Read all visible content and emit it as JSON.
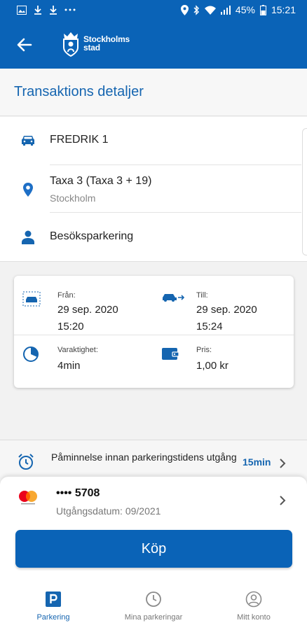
{
  "status_bar": {
    "battery": "45%",
    "time": "15:21"
  },
  "brand": {
    "line1": "Stockholms",
    "line2": "stad"
  },
  "page_title": "Transaktions detaljer",
  "vehicle": {
    "name": "FREDRIK 1"
  },
  "zone": {
    "name": "Taxa 3 (Taxa 3 + 19)",
    "city": "Stockholm"
  },
  "permit": {
    "type": "Besöksparkering"
  },
  "details": {
    "from": {
      "label": "Från:",
      "date": "29 sep. 2020",
      "time": "15:20"
    },
    "to": {
      "label": "Till:",
      "date": "29 sep. 2020",
      "time": "15:24"
    },
    "duration": {
      "label": "Varaktighet:",
      "value": "4min"
    },
    "price": {
      "label": "Pris:",
      "value": "1,00 kr"
    }
  },
  "reminder": {
    "label": "Påminnelse innan parkeringstidens utgång",
    "value": "15min"
  },
  "payment": {
    "card_number": "•••• 5708",
    "expiry": "Utgångsdatum: 09/2021"
  },
  "buy_button": "Köp",
  "bottom_nav": {
    "items": [
      {
        "label": "Parkering",
        "icon": "parking-icon",
        "active": true
      },
      {
        "label": "Mina parkeringar",
        "icon": "clock-icon",
        "active": false
      },
      {
        "label": "Mitt konto",
        "icon": "account-icon",
        "active": false
      }
    ]
  },
  "colors": {
    "primary": "#0a63b7",
    "accent_text": "#1565b0"
  }
}
